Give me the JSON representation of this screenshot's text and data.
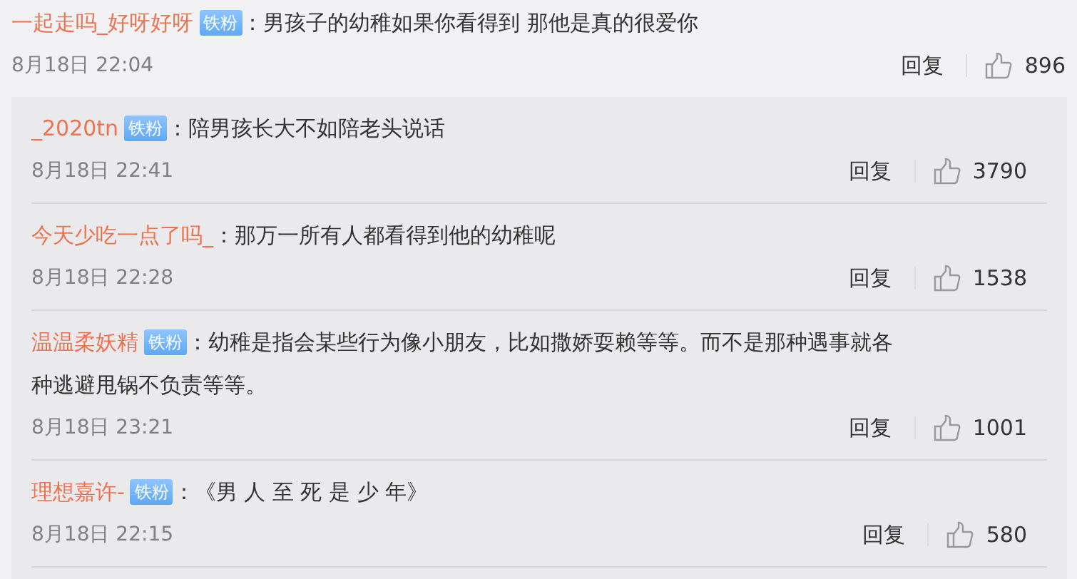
{
  "comment": {
    "user": "一起走吗_好呀好呀",
    "badge": "铁粉",
    "lines": [
      "：男孩子的幼稚如果你看得到 那他是真的很爱你"
    ],
    "time": "8月18日 22:04",
    "reply": "回复",
    "likes": "896"
  },
  "replies": [
    {
      "user": "_2020tn",
      "badge": "铁粉",
      "lines": [
        "：陪男孩长大不如陪老头说话"
      ],
      "time": "8月18日 22:41",
      "reply": "回复",
      "likes": "3790"
    },
    {
      "user": "今天少吃一点了吗_",
      "lines": [
        "：那万一所有人都看得到他的幼稚呢"
      ],
      "time": "8月18日 22:28",
      "reply": "回复",
      "likes": "1538"
    },
    {
      "user": "温温柔妖精",
      "badge": "铁粉",
      "lines": [
        "：幼稚是指会某些行为像小朋友，比如撒娇耍赖等等。而不是那种遇事就各",
        "种逃避甩锅不负责等等。"
      ],
      "time": "8月18日 23:21",
      "reply": "回复",
      "likes": "1001"
    },
    {
      "user": "理想嘉许-",
      "badge": "铁粉",
      "lines": [
        "：《男 人 至 死 是 少 年》"
      ],
      "time": "8月18日 22:15",
      "reply": "回复",
      "likes": "580"
    }
  ]
}
